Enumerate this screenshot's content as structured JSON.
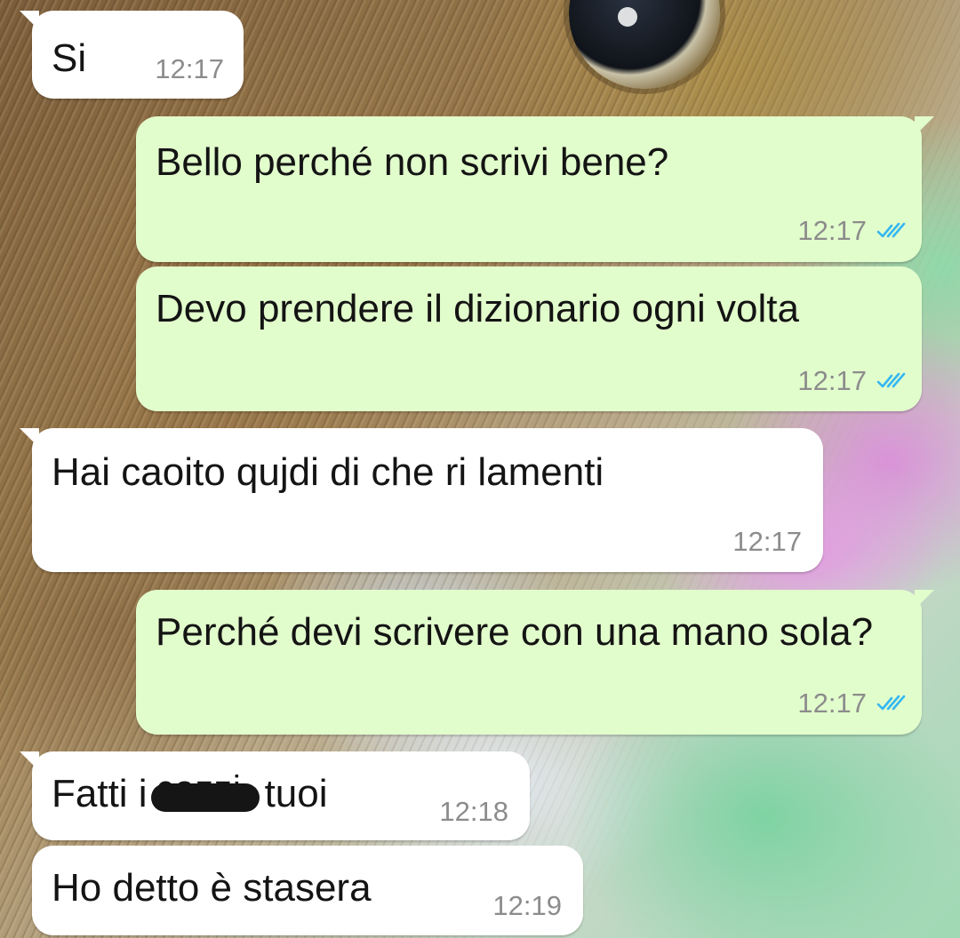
{
  "colors": {
    "incoming_bubble": "#ffffff",
    "outgoing_bubble": "#e2fdcc",
    "timestamp": "#8c8c8c",
    "read_ticks": "#34b7f1",
    "text": "#141414"
  },
  "wallpaper": {
    "icon": "rabbit-photo-wallpaper"
  },
  "messages": [
    {
      "direction": "incoming",
      "text": "Si",
      "time": "12:17"
    },
    {
      "direction": "outgoing",
      "text": "Bello perché non scrivi bene?",
      "time": "12:17",
      "status": "read"
    },
    {
      "direction": "outgoing",
      "text": "Devo prendere il dizionario ogni volta",
      "time": "12:17",
      "status": "read"
    },
    {
      "direction": "incoming",
      "text": "Hai caoito qujdi di che ri lamenti",
      "time": "12:17"
    },
    {
      "direction": "outgoing",
      "text": "Perché devi scrivere con una mano sola?",
      "time": "12:17",
      "status": "read"
    },
    {
      "direction": "incoming",
      "text_before": "Fatti i",
      "redacted_peek": "cazzi",
      "text_after": "tuoi",
      "time": "12:18"
    },
    {
      "direction": "incoming",
      "text": "Ho detto è stasera",
      "time": "12:19"
    }
  ]
}
